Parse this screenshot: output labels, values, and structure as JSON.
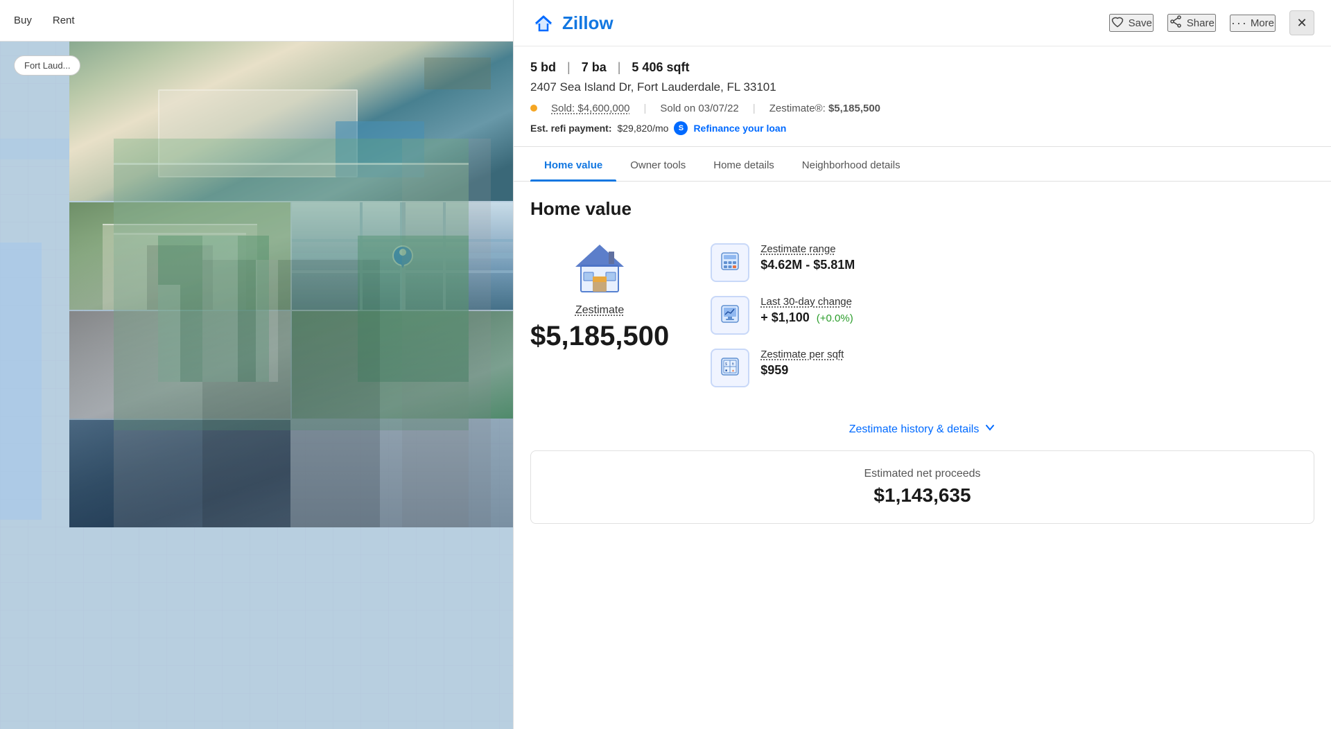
{
  "nav": {
    "buy_label": "Buy",
    "rent_label": "Rent",
    "location_label": "Fort Laud..."
  },
  "header": {
    "logo_text": "Zillow",
    "save_label": "Save",
    "share_label": "Share",
    "more_label": "More",
    "close_label": "✕"
  },
  "property": {
    "beds": "5 bd",
    "baths": "7 ba",
    "sqft": "5 406 sqft",
    "address": "2407 Sea Island Dr, Fort Lauderdale, FL 33101",
    "sold_price": "Sold: $4,600,000",
    "sold_date": "Sold on 03/07/22",
    "zestimate_label": "Zestimate®:",
    "zestimate_value": "$5,185,500",
    "refi_label": "Est. refi payment:",
    "refi_amount": "$29,820/mo",
    "refi_link": "Refinance your loan"
  },
  "tabs": {
    "items": [
      {
        "id": "home-value",
        "label": "Home value",
        "active": true
      },
      {
        "id": "owner-tools",
        "label": "Owner tools",
        "active": false
      },
      {
        "id": "home-details",
        "label": "Home details",
        "active": false
      },
      {
        "id": "neighborhood-details",
        "label": "Neighborhood details",
        "active": false
      }
    ]
  },
  "home_value": {
    "section_title": "Home value",
    "zestimate_sub_label": "Zestimate",
    "zestimate_big": "$5,185,500",
    "range_label": "Zestimate range",
    "range_value": "$4.62M - $5.81M",
    "change_label": "Last 30-day change",
    "change_amount": "+ $1,100",
    "change_pct": "(+0.0%)",
    "per_sqft_label": "Zestimate per sqft",
    "per_sqft_value": "$959",
    "history_link": "Zestimate history & details",
    "net_proceeds_label": "Estimated net proceeds",
    "net_proceeds_value": "$1,143,635"
  }
}
